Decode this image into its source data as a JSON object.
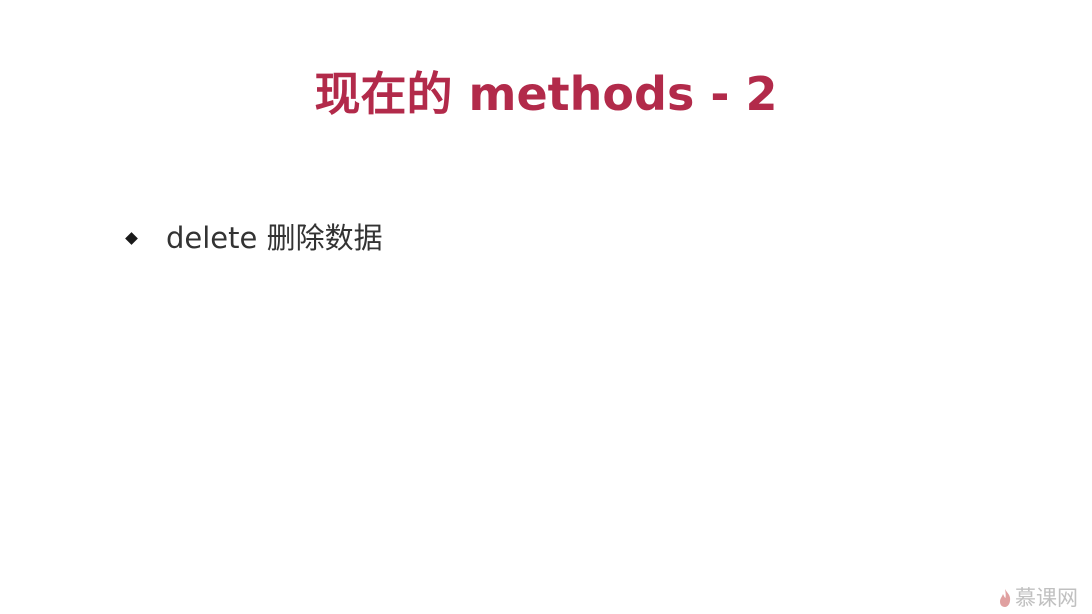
{
  "slide": {
    "title": "现在的 methods - 2",
    "bullets": [
      {
        "text": "delete 删除数据",
        "icon": "diamond-bullet-icon"
      }
    ],
    "watermark": {
      "text": "慕课网",
      "icon": "flame-icon"
    }
  },
  "colors": {
    "title": "#b22a4a",
    "bullet_marker": "#1a1a1a",
    "body_text": "#333333",
    "watermark": "#c0c0c0",
    "background": "#ffffff"
  }
}
